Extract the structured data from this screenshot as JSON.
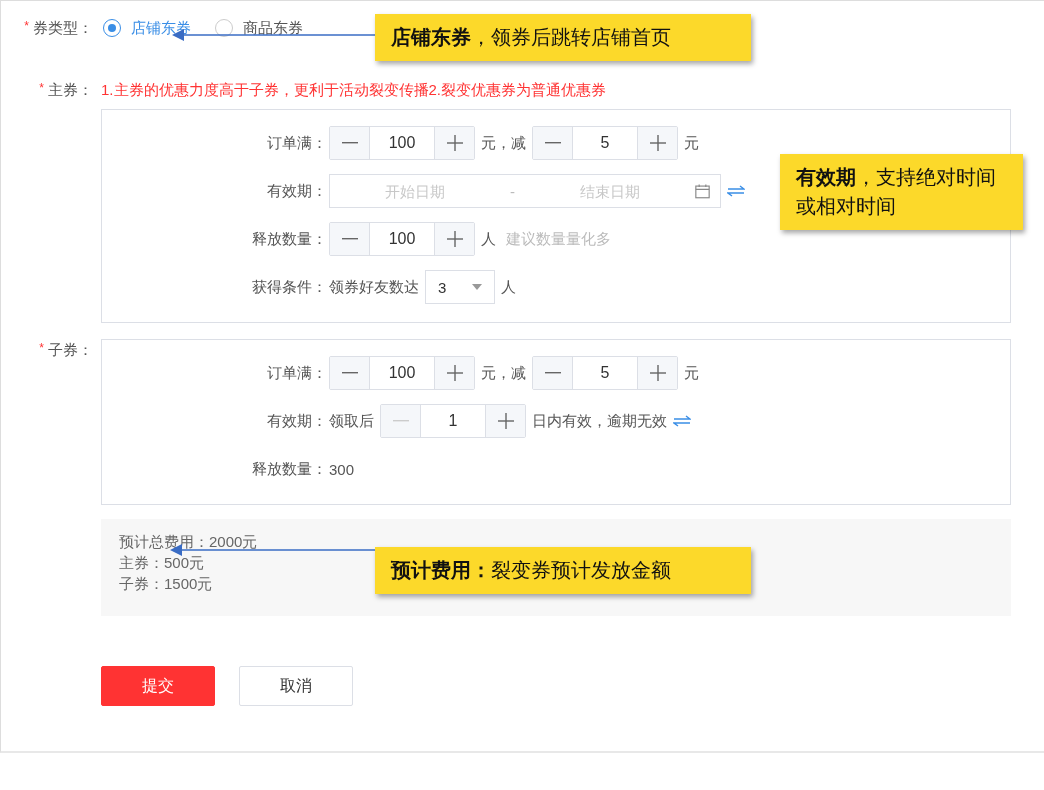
{
  "coupon_type": {
    "label": "券类型：",
    "required_mark": "*",
    "options": [
      {
        "label": "店铺东券",
        "selected": true
      },
      {
        "label": "商品东券",
        "selected": false
      }
    ]
  },
  "main_coupon": {
    "label": "主券：",
    "required_mark": "*",
    "hint": "1.主券的优惠力度高于子券，更利于活动裂变传播2.裂变优惠券为普通优惠券",
    "rows": [
      {
        "label": "订单满：",
        "parts": [
          {
            "kind": "stepper",
            "value": "100",
            "minus_disabled": false
          },
          {
            "kind": "text",
            "text": "元，减"
          },
          {
            "kind": "stepper",
            "value": "5",
            "minus_disabled": false
          },
          {
            "kind": "text",
            "text": "元"
          }
        ]
      },
      {
        "label": "有效期：",
        "parts": [
          {
            "kind": "date_range",
            "start_placeholder": "开始日期",
            "separator": "-",
            "end_placeholder": "结束日期"
          },
          {
            "kind": "swap"
          }
        ]
      },
      {
        "label": "释放数量：",
        "parts": [
          {
            "kind": "stepper",
            "value": "100",
            "minus_disabled": false
          },
          {
            "kind": "text",
            "text": "人"
          },
          {
            "kind": "hint",
            "text": "建议数量量化多"
          }
        ]
      },
      {
        "label": "获得条件：",
        "parts": [
          {
            "kind": "text",
            "text": "领券好友数达"
          },
          {
            "kind": "select",
            "value": "3"
          },
          {
            "kind": "text",
            "text": "人"
          }
        ]
      }
    ]
  },
  "sub_coupon": {
    "label": "子券：",
    "required_mark": "*",
    "rows": [
      {
        "label": "订单满：",
        "parts": [
          {
            "kind": "stepper",
            "value": "100",
            "minus_disabled": false
          },
          {
            "kind": "text",
            "text": "元，减"
          },
          {
            "kind": "stepper",
            "value": "5",
            "minus_disabled": false
          },
          {
            "kind": "text",
            "text": "元"
          }
        ]
      },
      {
        "label": "有效期：",
        "parts": [
          {
            "kind": "text",
            "text": "领取后"
          },
          {
            "kind": "stepper",
            "value": "1",
            "minus_disabled": true
          },
          {
            "kind": "text",
            "text": "日内有效，逾期无效"
          },
          {
            "kind": "swap"
          }
        ]
      },
      {
        "label": "释放数量：",
        "parts": [
          {
            "kind": "text",
            "text": "300"
          }
        ]
      }
    ]
  },
  "cost_summary": [
    "预计总费用：2000元",
    "主券：500元",
    "子券：1500元"
  ],
  "buttons": [
    {
      "label": "提交",
      "kind": "primary"
    },
    {
      "label": "取消",
      "kind": "default"
    }
  ],
  "callouts": [
    {
      "text": "**店铺东券**，领券后跳转店铺首页",
      "arrow": true
    },
    {
      "text": "**有效期**，支持绝对时间或相对时间",
      "arrow": false
    },
    {
      "text": "**预计费用：**裂变券预计发放金额",
      "arrow": true
    }
  ]
}
